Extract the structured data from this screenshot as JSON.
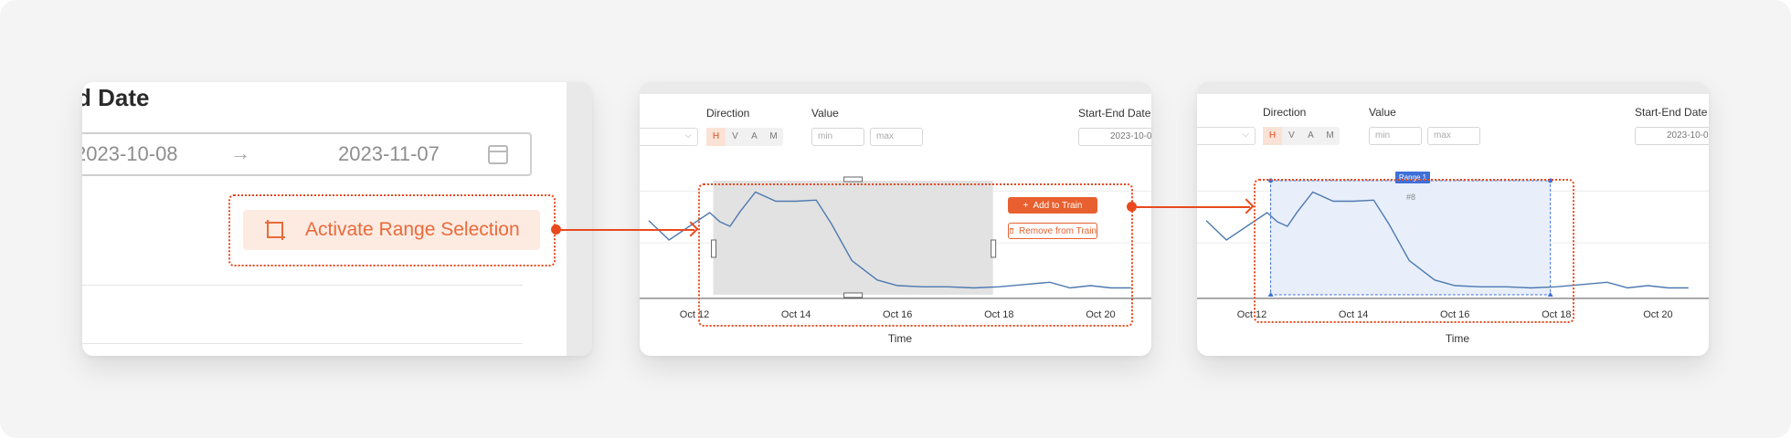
{
  "colors": {
    "accent": "#e8491d",
    "accent_soft": "#fdebe2",
    "selection_blue": "#3f6fd8",
    "line": "#4e79b0",
    "canvas": "#f4f4f4"
  },
  "panel_one": {
    "title": "d Date",
    "start_date": "2023-10-08",
    "end_date": "2023-11-07",
    "arrow_icon": "arrow-right-icon",
    "calendar_icon": "calendar-icon",
    "activate_button": {
      "label": "Activate Range Selection",
      "icon": "crop-select-icon"
    }
  },
  "toolbar": {
    "direction_label": "Direction",
    "value_label": "Value",
    "date_label": "Start-End Date",
    "direction_options": [
      "H",
      "V",
      "A",
      "M"
    ],
    "selected_direction": "H",
    "min_placeholder": "min",
    "max_placeholder": "max",
    "date_value": "2023-10-0"
  },
  "panel_two": {
    "add_button": "Add to Train",
    "remove_button": "Remove from Train",
    "add_icon": "plus-icon",
    "remove_icon": "trash-icon"
  },
  "panel_three": {
    "range_tag": "Range 1",
    "range_index": "#8"
  },
  "chart_data": [
    {
      "type": "line",
      "x_label": "Time",
      "x_ticks": [
        "Oct 12",
        "Oct 14",
        "Oct 16",
        "Oct 18",
        "Oct 20"
      ],
      "x": [
        11.1,
        11.5,
        11.9,
        12.3,
        12.5,
        12.7,
        12.9,
        13.2,
        13.6,
        14.0,
        14.4,
        14.7,
        15.1,
        15.6,
        16.0,
        16.5,
        17.0,
        17.5,
        18.0,
        18.5,
        19.0,
        19.4,
        19.8,
        20.2,
        20.6
      ],
      "y": [
        0.65,
        0.48,
        0.6,
        0.72,
        0.64,
        0.6,
        0.73,
        0.9,
        0.82,
        0.82,
        0.83,
        0.62,
        0.3,
        0.13,
        0.08,
        0.07,
        0.07,
        0.06,
        0.07,
        0.09,
        0.11,
        0.06,
        0.08,
        0.06,
        0.06
      ],
      "xlim": [
        11.1,
        21.0
      ],
      "ylim": [
        0,
        1
      ],
      "selection": {
        "x_start": 12.37,
        "x_end": 17.88,
        "style": "grey brush"
      }
    },
    {
      "type": "line",
      "x_label": "Time",
      "x_ticks": [
        "Oct 12",
        "Oct 14",
        "Oct 16",
        "Oct 18",
        "Oct 20"
      ],
      "x": [
        11.1,
        11.5,
        11.9,
        12.3,
        12.5,
        12.7,
        12.9,
        13.2,
        13.6,
        14.0,
        14.4,
        14.7,
        15.1,
        15.6,
        16.0,
        16.5,
        17.0,
        17.5,
        18.0,
        18.5,
        19.0,
        19.4,
        19.8,
        20.2,
        20.6
      ],
      "y": [
        0.65,
        0.48,
        0.6,
        0.72,
        0.64,
        0.6,
        0.73,
        0.9,
        0.82,
        0.82,
        0.83,
        0.62,
        0.3,
        0.13,
        0.08,
        0.07,
        0.07,
        0.06,
        0.07,
        0.09,
        0.11,
        0.06,
        0.08,
        0.06,
        0.06
      ],
      "xlim": [
        11.1,
        21.0
      ],
      "ylim": [
        0,
        1
      ],
      "selection": {
        "x_start": 12.37,
        "x_end": 17.88,
        "style": "blue range",
        "label": "Range 1"
      }
    }
  ]
}
